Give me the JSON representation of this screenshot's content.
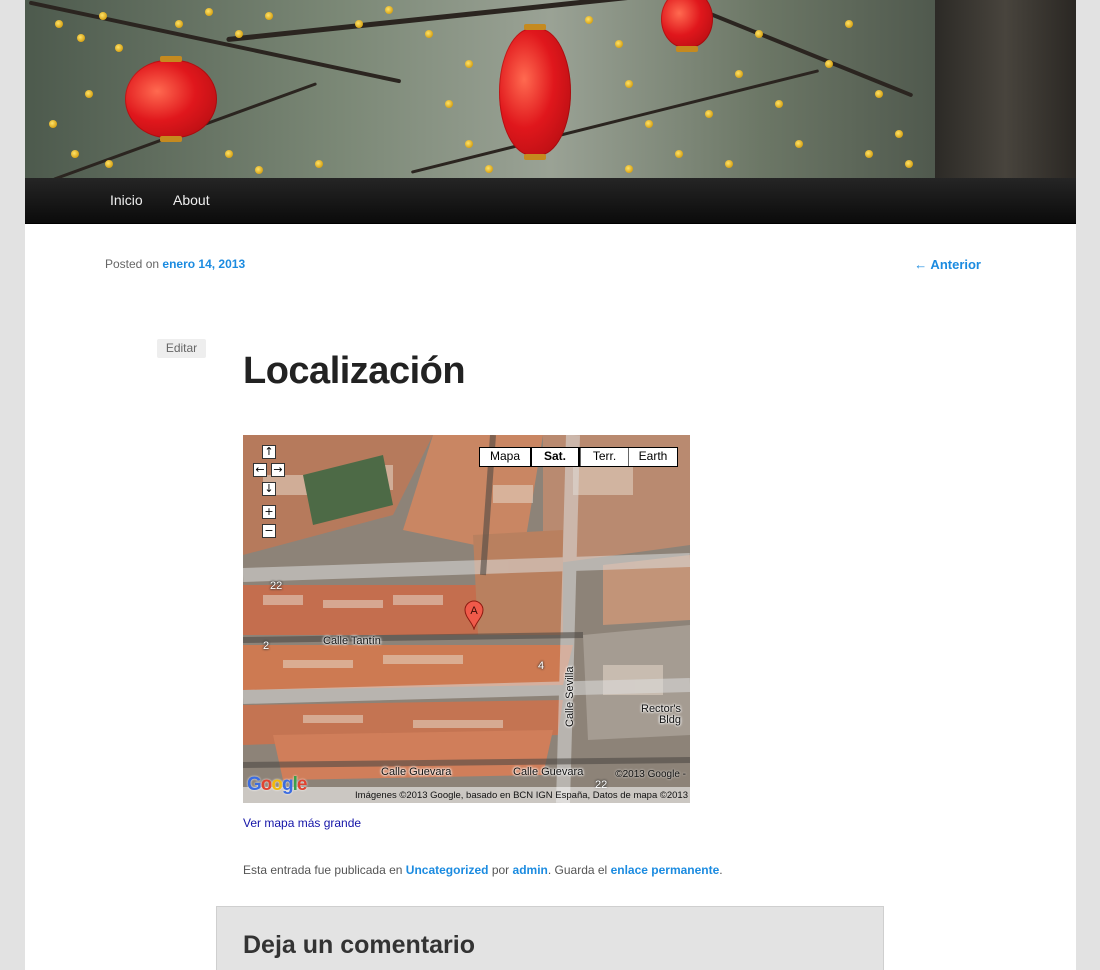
{
  "nav": {
    "items": [
      {
        "label": "Inicio"
      },
      {
        "label": "About"
      }
    ]
  },
  "post": {
    "posted_prefix": "Posted on",
    "date": "enero 14, 2013",
    "prev_link": "← Anterior",
    "edit_label": "Editar",
    "title": "Localización"
  },
  "map": {
    "types": [
      {
        "label": "Mapa",
        "active": false
      },
      {
        "label": "Sat.",
        "active": true
      },
      {
        "label": "Terr.",
        "active": false
      },
      {
        "label": "Earth",
        "active": false
      }
    ],
    "controls": {
      "up": "↑",
      "left": "←",
      "right": "→",
      "down": "↓",
      "zoom_in": "+",
      "zoom_out": "−"
    },
    "marker_letter": "A",
    "streets": {
      "tantin": "Calle Tantín",
      "sevilla": "Calle Sevilla",
      "guevara_1": "Calle Guevara",
      "guevara_2": "Calle Guevara",
      "rectors": "Rector's Bldg"
    },
    "numbers": {
      "n22": "22",
      "n2": "2",
      "n4": "4",
      "n22b": "22"
    },
    "copyright": "©2013 Google -",
    "attribution": "Imágenes ©2013 Google, basado en BCN IGN España, Datos de mapa ©2013",
    "logo": "Google",
    "larger_link": "Ver mapa más grande"
  },
  "entry_meta": {
    "prefix": "Esta entrada fue publicada en",
    "category": "Uncategorized",
    "by": "por",
    "author": "admin",
    "save_text": ". Guarda el",
    "permalink": "enlace permanente",
    "end": "."
  },
  "comments": {
    "title": "Deja un comentario"
  },
  "colors": {
    "link": "#1b8be0",
    "nav_bg": "#0b0b0b",
    "page_bg": "#e2e2e2"
  }
}
